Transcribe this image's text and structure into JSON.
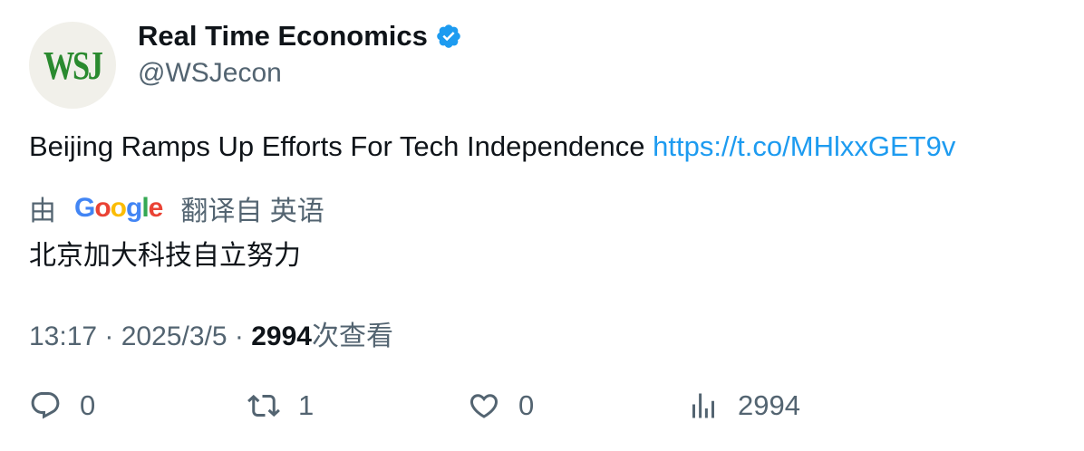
{
  "account": {
    "avatar_text": "WSJ",
    "display_name": "Real Time Economics",
    "handle": "@WSJecon"
  },
  "tweet": {
    "text": "Beijing Ramps Up Efforts For Tech Independence ",
    "link": "https://t.co/MHlxxGET9v"
  },
  "translation": {
    "by_label": "由",
    "google_letters": [
      "G",
      "o",
      "o",
      "g",
      "l",
      "e"
    ],
    "google_colors": [
      "#4285f4",
      "#ea4335",
      "#fbbc05",
      "#4285f4",
      "#34a853",
      "#ea4335"
    ],
    "from_label": "翻译自 英语",
    "translated_text": "北京加大科技自立努力"
  },
  "meta": {
    "time": "13:17",
    "sep1": " · ",
    "date": "2025/3/5",
    "sep2": " · ",
    "views": "2994",
    "views_label": "次查看"
  },
  "actions": {
    "reply_count": "0",
    "retweet_count": "1",
    "like_count": "0",
    "views_count": "2994"
  },
  "colors": {
    "link": "#1d9bf0",
    "verified": "#1d9bf0",
    "secondary_text": "#536471",
    "avatar_green": "#2a8a2f"
  },
  "icons": [
    "verified-badge-icon",
    "reply-icon",
    "retweet-icon",
    "like-icon",
    "views-icon"
  ]
}
